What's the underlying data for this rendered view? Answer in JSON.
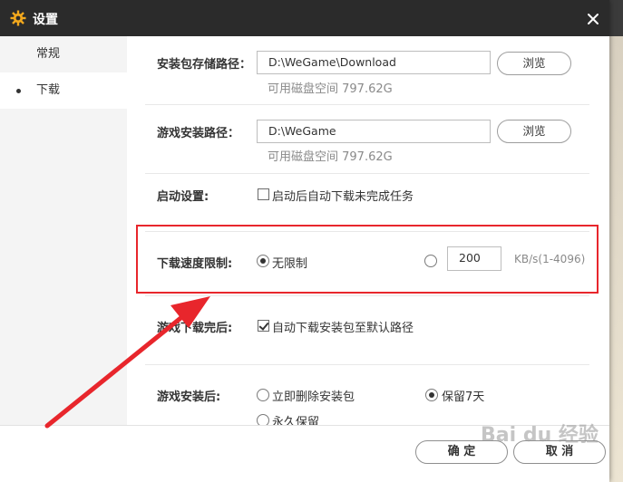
{
  "colors": {
    "titlebar": "#2b2b2b",
    "accent_gear": "#f2a81d",
    "highlight": "#e8262c"
  },
  "dialog": {
    "title": "设置",
    "title_icon": "gear-icon",
    "close_icon": "close-icon"
  },
  "sidebar": {
    "items": [
      {
        "label": "常规"
      },
      {
        "label": "下载"
      }
    ],
    "active_index": 1
  },
  "install_package_path": {
    "label": "安装包存储路径：",
    "value": "D:\\WeGame\\Download",
    "browse": "浏览",
    "free_space": "可用磁盘空间 797.62G"
  },
  "game_install_path": {
    "label": "游戏安装路径：",
    "value": "D:\\WeGame",
    "browse": "浏览",
    "free_space": "可用磁盘空间 797.62G"
  },
  "startup": {
    "label": "启动设置:",
    "auto_download": {
      "label": "启动后自动下载未完成任务",
      "checked": false
    }
  },
  "speed_limit": {
    "label": "下载速度限制:",
    "unlimited": {
      "label": "无限制",
      "checked": true
    },
    "custom": {
      "checked": false
    },
    "value": "200",
    "unit": "KB/s(1-4096)"
  },
  "after_download": {
    "label": "游戏下载完后:",
    "auto_install": {
      "label": "自动下载安装包至默认路径",
      "checked": true
    }
  },
  "after_install": {
    "label": "游戏安装后:",
    "options": [
      {
        "label": "立即删除安装包",
        "checked": false
      },
      {
        "label": "保留7天",
        "checked": true
      },
      {
        "label": "永久保留",
        "checked": false
      }
    ]
  },
  "footer": {
    "ok": "确 定",
    "cancel": "取 消"
  },
  "watermark": "Bai du 经验"
}
